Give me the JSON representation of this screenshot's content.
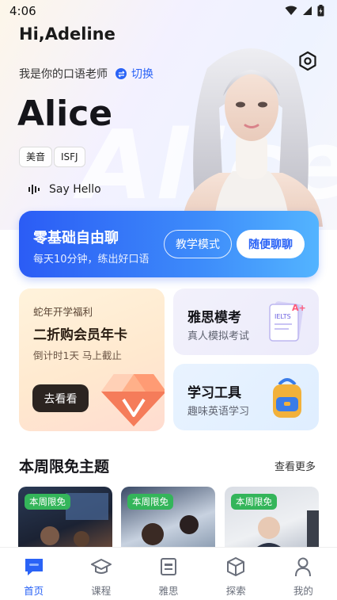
{
  "status_bar": {
    "time": "4:06"
  },
  "hero": {
    "greeting": "Hi,Adeline",
    "intro": "我是你的口语老师",
    "switch_label": "切换",
    "teacher_name": "Alice",
    "watermark": "Alice",
    "tags": [
      "美音",
      "ISFJ"
    ],
    "say_hello": "Say Hello"
  },
  "chat_banner": {
    "title": "零基础自由聊",
    "subtitle": "每天10分钟，练出好口语",
    "teach_mode_label": "教学模式",
    "free_chat_label": "随便聊聊"
  },
  "promo": {
    "small": "蛇年开学福利",
    "title": "二折购会员年卡",
    "desc": "倒计时1天 马上截止",
    "button": "去看看"
  },
  "ielts_card": {
    "title": "雅思模考",
    "subtitle": "真人模拟考试",
    "illus_text": "IELTS"
  },
  "tools_card": {
    "title": "学习工具",
    "subtitle": "趣味英语学习"
  },
  "weekly": {
    "title": "本周限免主题",
    "more": "查看更多",
    "cards": [
      {
        "badge": "本周限免"
      },
      {
        "badge": "本周限免"
      },
      {
        "badge": "本周限免"
      }
    ]
  },
  "tab_bar": {
    "tabs": [
      {
        "label": "首页",
        "icon": "home-chat-icon",
        "active": true
      },
      {
        "label": "课程",
        "icon": "graduation-cap-icon",
        "active": false
      },
      {
        "label": "雅思",
        "icon": "ielts-book-icon",
        "active": false
      },
      {
        "label": "探索",
        "icon": "cube-icon",
        "active": false
      },
      {
        "label": "我的",
        "icon": "person-icon",
        "active": false
      }
    ]
  },
  "colors": {
    "primary": "#2a63f6",
    "badge_green": "#34b55a",
    "promo_button": "#2b2420"
  }
}
